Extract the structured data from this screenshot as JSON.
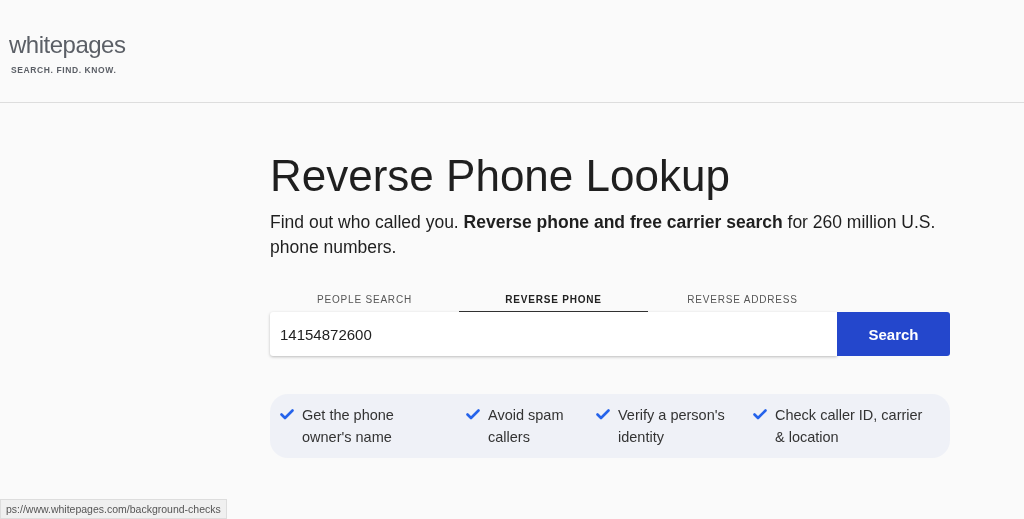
{
  "logo": {
    "name": "whitepages",
    "tagline": "SEARCH. FIND. KNOW."
  },
  "title": "Reverse Phone Lookup",
  "intro": "Find out who called you. **Reverse phone and free carrier search** for 260 million U.S. phone numbers.",
  "tabs": [
    {
      "label": "PEOPLE SEARCH",
      "selected": false
    },
    {
      "label": "REVERSE PHONE",
      "selected": true
    },
    {
      "label": "REVERSE ADDRESS",
      "selected": false
    }
  ],
  "search": {
    "value": "14154872600",
    "button": "Search"
  },
  "features": [
    "Get the phone owner's name",
    "Avoid spam callers",
    "Verify a person's identity",
    "Check caller ID, carrier & location"
  ],
  "status_bar": "ps://www.whitepages.com/background-checks"
}
